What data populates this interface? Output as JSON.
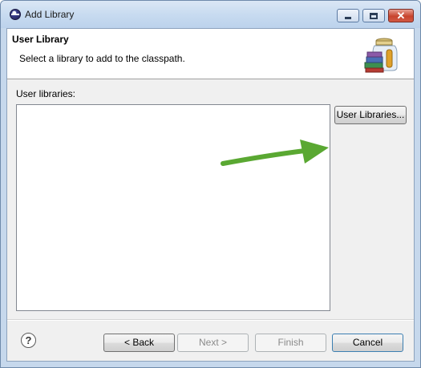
{
  "window": {
    "title": "Add Library",
    "controls": [
      "minimize-icon",
      "maximize-icon",
      "close-icon"
    ]
  },
  "header": {
    "title": "User Library",
    "description": "Select a library to add to the classpath.",
    "icon": "library-jar-icon"
  },
  "main": {
    "list_label": "User libraries:",
    "user_libraries_button": "User Libraries...",
    "annotation_arrow_color": "#5aa832"
  },
  "footer": {
    "help_icon": "?",
    "back": "< Back",
    "next": "Next >",
    "finish": "Finish",
    "cancel": "Cancel"
  }
}
